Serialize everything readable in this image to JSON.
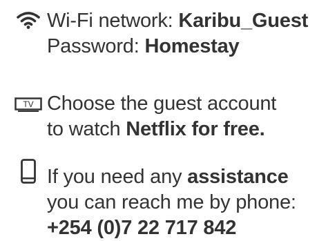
{
  "wifi": {
    "icon": "wifi-icon",
    "network_label": "Wi-Fi network: ",
    "network_value": "Karibu_Guest",
    "password_label": "Password: ",
    "password_value": "Homestay"
  },
  "tv": {
    "icon": "tv-icon",
    "icon_text": "TV",
    "line1": "Choose the guest account",
    "line2_prefix": "to watch ",
    "line2_bold": "Netflix for free."
  },
  "phone": {
    "icon": "smartphone-icon",
    "line1_prefix": "If you need any ",
    "line1_bold": "assistance",
    "line2": "you can reach me by phone:",
    "number": "+254 (0)7 22 717 842"
  }
}
